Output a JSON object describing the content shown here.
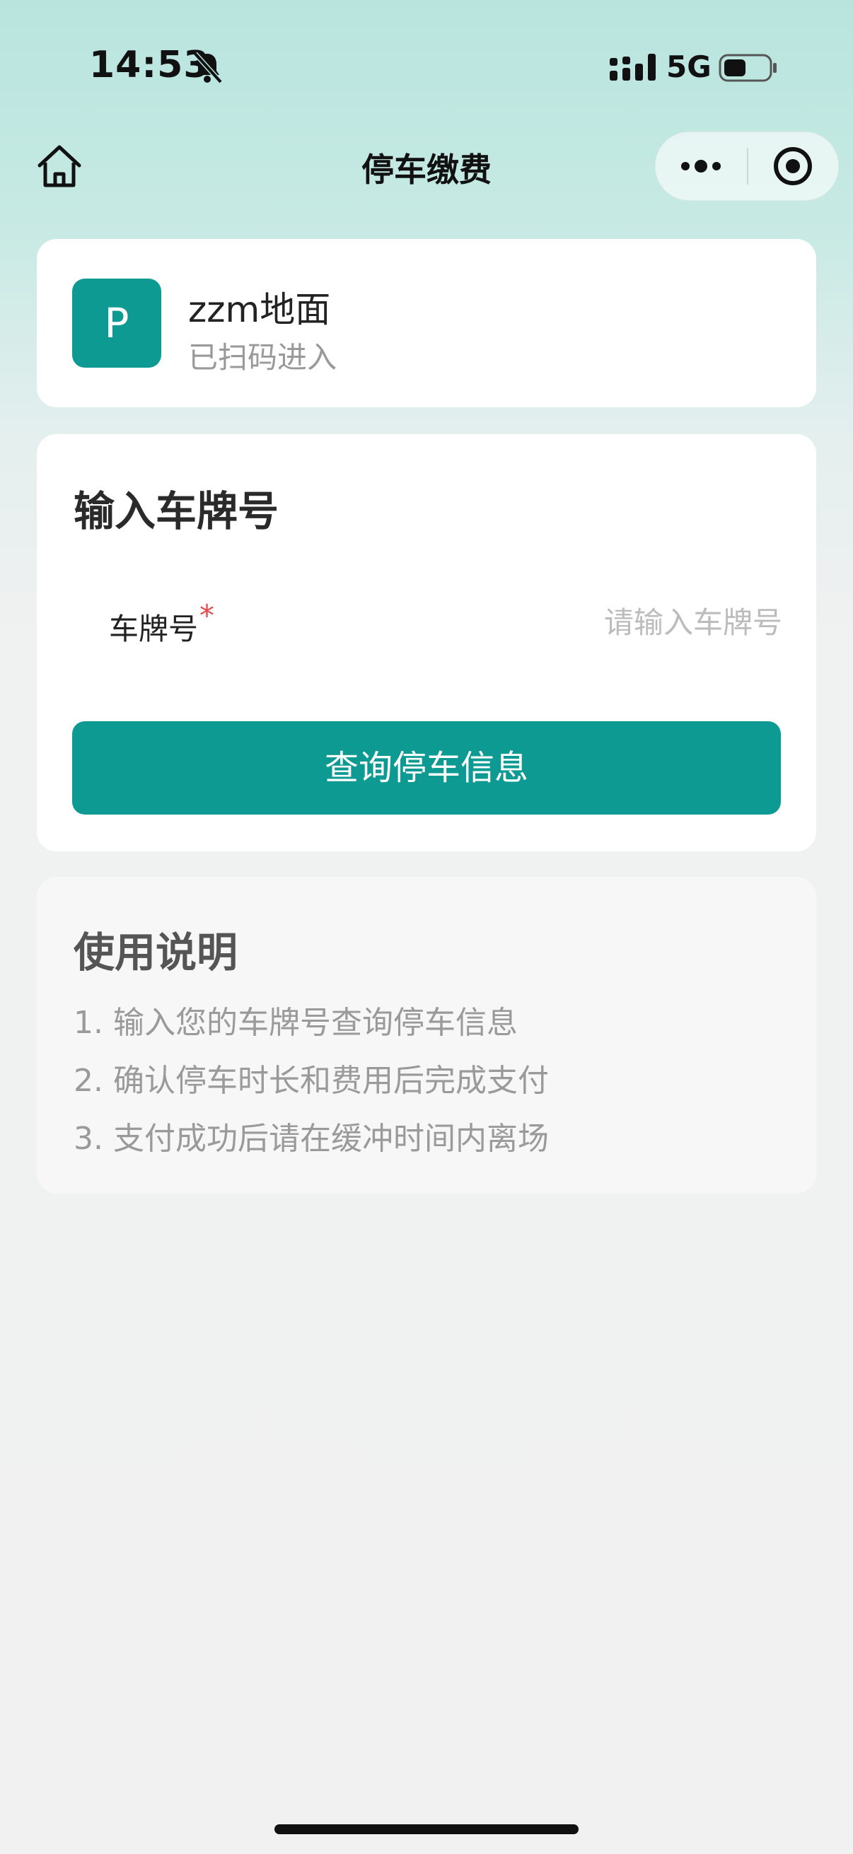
{
  "status_bar": {
    "time": "14:53",
    "network": "5G",
    "icons": [
      "bell-slash-icon",
      "signal-icon",
      "battery-icon"
    ]
  },
  "nav": {
    "title": "停车缴费",
    "icons": [
      "home-icon",
      "more-icon",
      "target-icon"
    ]
  },
  "parking_lot": {
    "icon_letter": "P",
    "name": "zzm地面",
    "status": "已扫码进入"
  },
  "plate_form": {
    "title": "输入车牌号",
    "label": "车牌号",
    "required_mark": "*",
    "value": "",
    "placeholder": "请输入车牌号",
    "submit_label": "查询停车信息"
  },
  "instructions": {
    "title": "使用说明",
    "items": [
      "1. 输入您的车牌号查询停车信息",
      "2. 确认停车时长和费用后完成支付",
      "3. 支付成功后请在缓冲时间内离场"
    ]
  },
  "colors": {
    "accent": "#0c9a93",
    "required": "#e5484d",
    "header_gradient_top": "#b9e4de",
    "page_bg": "#f1f1f1"
  }
}
